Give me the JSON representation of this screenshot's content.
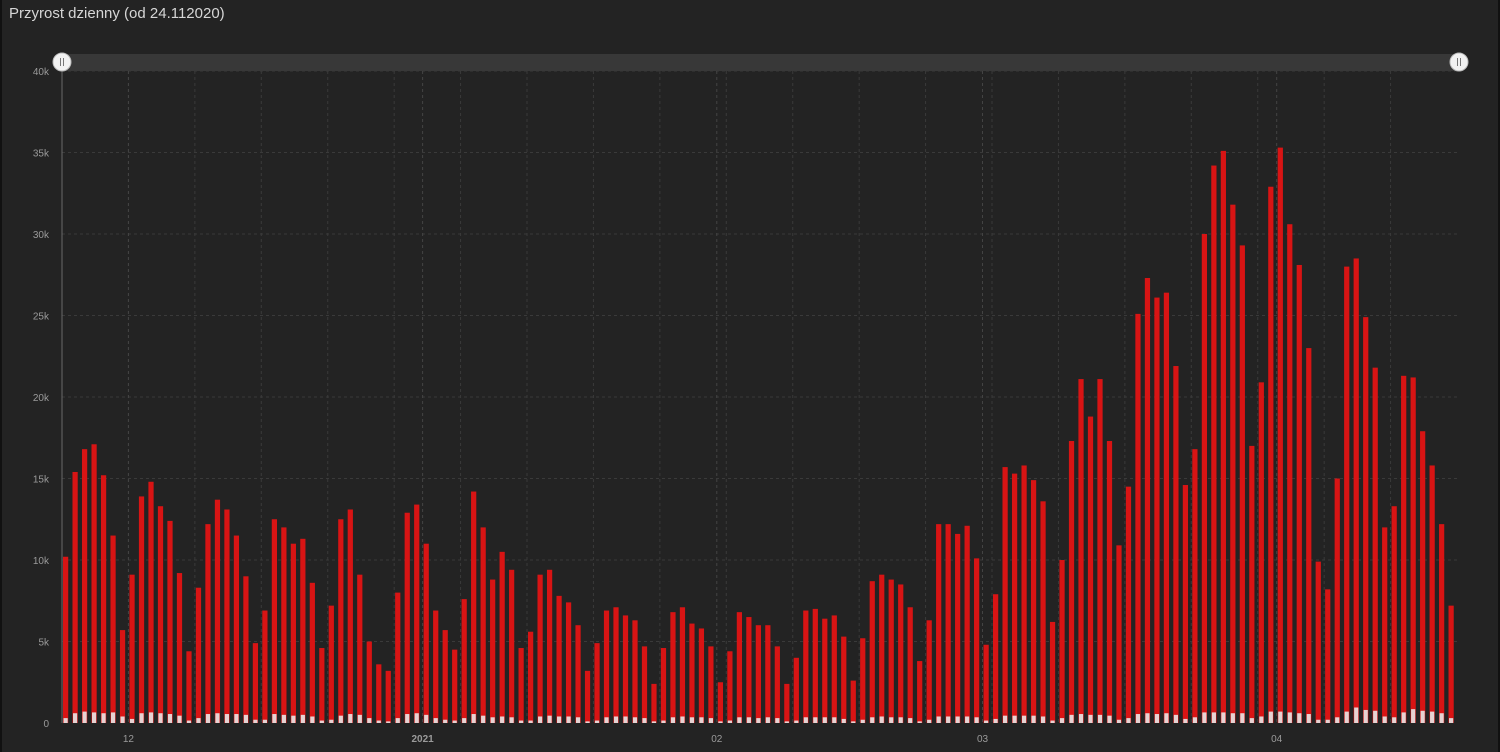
{
  "header": {
    "title": "Przyrost dzienny (od 24.112020)"
  },
  "colors": {
    "background": "#232323",
    "bar_primary": "#d81414",
    "bar_secondary": "#e8e8e8",
    "grid": "#3a3a3a",
    "scroll_track": "#383838"
  },
  "chart_data": {
    "type": "bar",
    "title": "Przyrost dzienny (od 24.112020)",
    "xlabel": "",
    "ylabel": "",
    "ylim": [
      0,
      40000
    ],
    "grid": true,
    "y_ticks": [
      "0",
      "5k",
      "10k",
      "15k",
      "20k",
      "25k",
      "30k",
      "35k",
      "40k"
    ],
    "x_ticks": [
      {
        "label": "12",
        "index": 7
      },
      {
        "label": "2021",
        "index": 38
      },
      {
        "label": "02",
        "index": 69
      },
      {
        "label": "03",
        "index": 97
      },
      {
        "label": "04",
        "index": 128
      }
    ],
    "series": [
      {
        "values": [
          10200,
          15400,
          16800,
          17100,
          15200,
          11500,
          5700,
          9100,
          13900,
          14800,
          13300,
          12400,
          9200,
          4400,
          8300,
          12200,
          13700,
          13100,
          11500,
          9000,
          4900,
          6900,
          12500,
          12000,
          11000,
          11300,
          8600,
          4600,
          7200,
          12500,
          13100,
          9100,
          5000,
          3600,
          3200,
          8000,
          12900,
          13400,
          11000,
          6900,
          5700,
          4500,
          7600,
          14200,
          12000,
          8800,
          10500,
          9400,
          4600,
          5600,
          9100,
          9400,
          7800,
          7400,
          6000,
          3200,
          4900,
          6900,
          7100,
          6600,
          6300,
          4700,
          2400,
          4600,
          6800,
          7100,
          6100,
          5800,
          4700,
          2500,
          4400,
          6800,
          6500,
          6000,
          6000,
          4700,
          2400,
          4000,
          6900,
          7000,
          6400,
          6600,
          5300,
          2600,
          5200,
          8700,
          9100,
          8800,
          8500,
          7100,
          3800,
          6300,
          12200,
          12200,
          11600,
          12100,
          10100,
          4800,
          7900,
          15700,
          15300,
          15800,
          14900,
          13600,
          6200,
          10000,
          17300,
          21100,
          18800,
          21100,
          17300,
          10900,
          14500,
          25100,
          27300,
          26100,
          26400,
          21900,
          14600,
          16800,
          30000,
          34200,
          35100,
          31800,
          29300,
          17000,
          20900,
          32900,
          35300,
          30600,
          28100,
          23000,
          9900,
          8200,
          15000,
          28000,
          28500,
          24900,
          21800,
          12000,
          13300,
          21300,
          21200,
          17900,
          15800,
          12200,
          7200
        ]
      },
      {
        "values": [
          300,
          600,
          700,
          650,
          600,
          650,
          400,
          250,
          600,
          650,
          600,
          550,
          450,
          150,
          300,
          550,
          600,
          550,
          550,
          500,
          200,
          200,
          550,
          500,
          450,
          500,
          400,
          150,
          200,
          450,
          550,
          500,
          300,
          150,
          100,
          300,
          550,
          600,
          500,
          300,
          200,
          150,
          300,
          550,
          450,
          350,
          400,
          350,
          150,
          150,
          400,
          450,
          400,
          400,
          350,
          100,
          150,
          350,
          400,
          400,
          350,
          300,
          100,
          150,
          350,
          400,
          350,
          350,
          300,
          100,
          150,
          350,
          350,
          300,
          350,
          300,
          100,
          150,
          350,
          350,
          350,
          350,
          250,
          100,
          200,
          350,
          400,
          350,
          350,
          300,
          100,
          200,
          400,
          400,
          400,
          400,
          350,
          150,
          250,
          450,
          450,
          450,
          450,
          400,
          150,
          300,
          500,
          550,
          500,
          500,
          450,
          200,
          300,
          550,
          600,
          550,
          600,
          500,
          250,
          350,
          650,
          650,
          650,
          600,
          600,
          300,
          400,
          700,
          700,
          650,
          600,
          550,
          200,
          200,
          350,
          700,
          950,
          800,
          750,
          400,
          350,
          650,
          850,
          750,
          700,
          600,
          300
        ]
      }
    ]
  }
}
